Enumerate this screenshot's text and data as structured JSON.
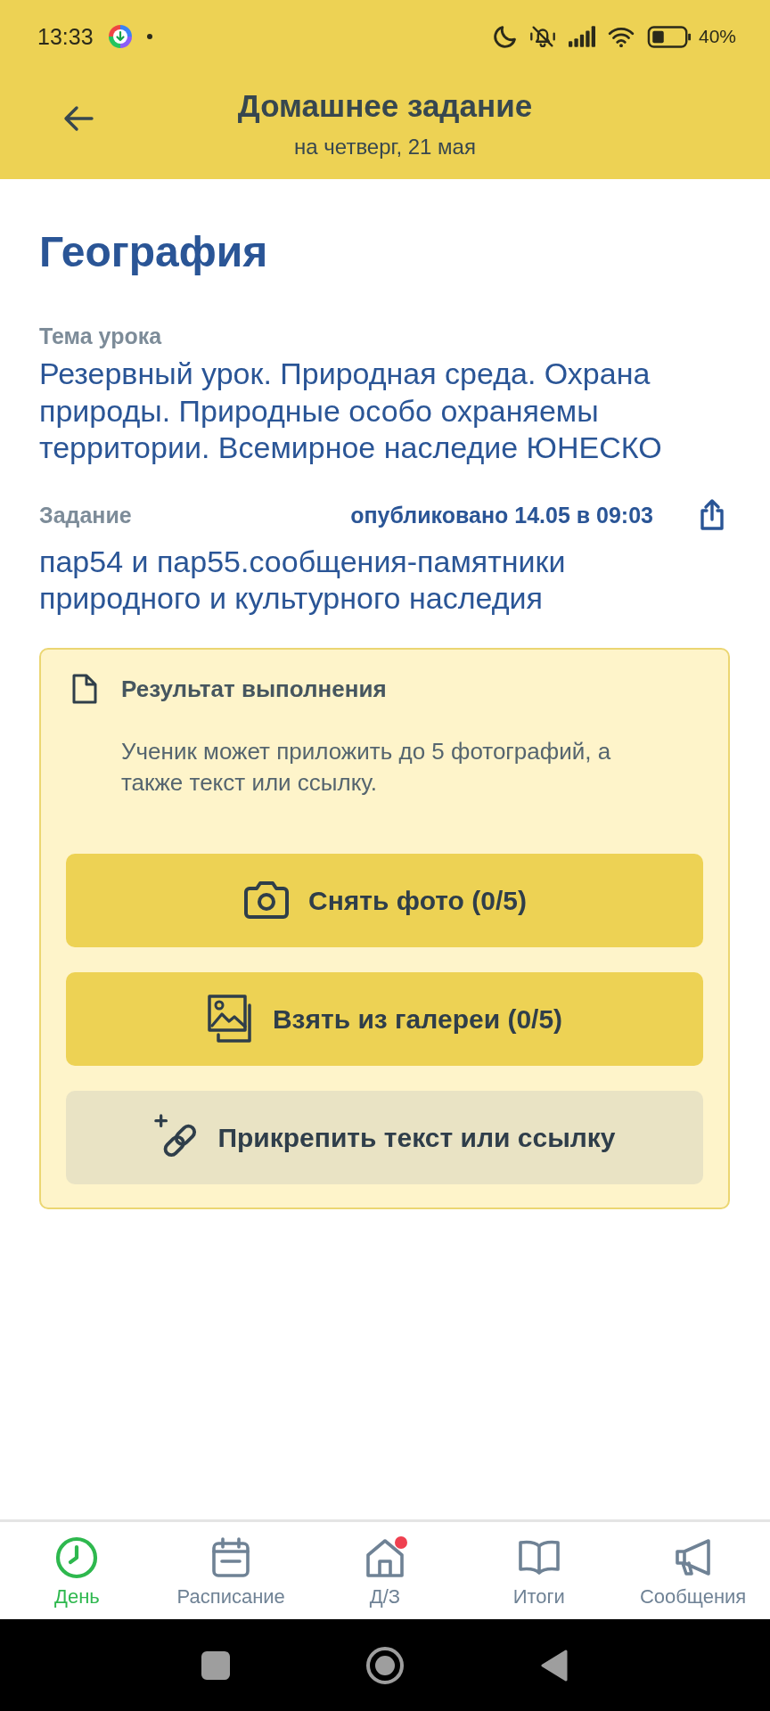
{
  "status_bar": {
    "time": "13:33",
    "battery": "40%"
  },
  "header": {
    "title": "Домашнее задание",
    "subtitle": "на четверг, 21 мая"
  },
  "subject": "География",
  "topic": {
    "label": "Тема урока",
    "text": "Резервный урок. Природная среда. Охрана природы. Природные особо охраняемы территории. Всемирное наследие ЮНЕСКО"
  },
  "assignment": {
    "label": "Задание",
    "published": "опубликовано 14.05 в 09:03",
    "text": "пар54 и пар55.сообщения-памятники природного и культурного наследия"
  },
  "result": {
    "title": "Результат выполнения",
    "hint": "Ученик может приложить до 5 фотографий, а также текст или ссылку.",
    "buttons": [
      {
        "kind": "camera",
        "label": "Снять фото (0/5)"
      },
      {
        "kind": "gallery",
        "label": "Взять из галереи (0/5)"
      },
      {
        "kind": "link",
        "label": "Прикрепить текст или ссылку"
      }
    ]
  },
  "bottom_nav": [
    {
      "kind": "clock",
      "label": "День",
      "selected": true,
      "notification": false
    },
    {
      "kind": "calendar",
      "label": "Расписание",
      "selected": false,
      "notification": false
    },
    {
      "kind": "house",
      "label": "Д/З",
      "selected": false,
      "notification": true
    },
    {
      "kind": "book",
      "label": "Итоги",
      "selected": false,
      "notification": false
    },
    {
      "kind": "megaphone",
      "label": "Сообщения",
      "selected": false,
      "notification": false
    }
  ]
}
